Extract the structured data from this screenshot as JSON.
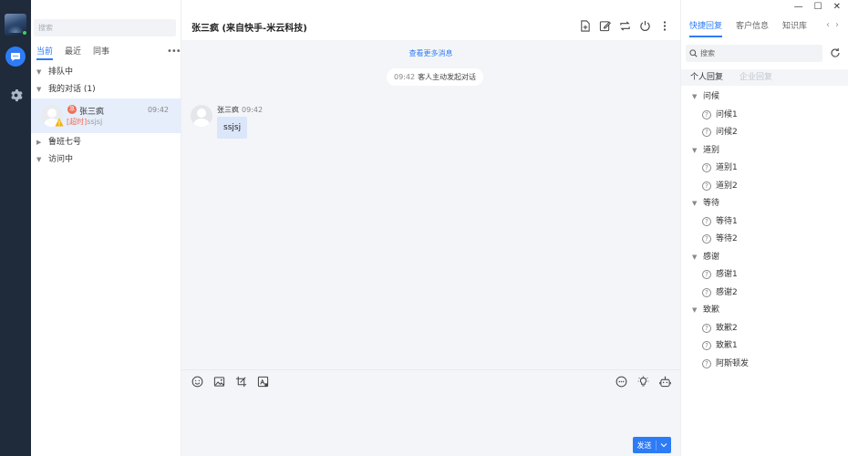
{
  "list": {
    "search_placeholder": "搜索",
    "tabs": [
      {
        "label": "当前",
        "active": true
      },
      {
        "label": "最近",
        "active": false
      },
      {
        "label": "同事",
        "active": false
      }
    ],
    "groups": {
      "queue": "排队中",
      "mine": "我的对话 (1)",
      "team": "鲁班七号",
      "visiting": "访问中"
    },
    "conversation": {
      "name": "张三疯",
      "time": "09:42",
      "badge": "急",
      "timeout_tag": "[超时]",
      "preview": "ssjsj"
    }
  },
  "chat": {
    "title": "张三疯 (来自快手-米云科技)",
    "more_messages": "查看更多消息",
    "system_message": {
      "time": "09:42",
      "text": "客人主动发起对话"
    },
    "message": {
      "sender": "张三疯",
      "time": "09:42",
      "text": "ssjsj"
    },
    "send_label": "发送"
  },
  "right": {
    "tabs": [
      {
        "label": "快捷回复",
        "active": true
      },
      {
        "label": "客户信息",
        "active": false
      },
      {
        "label": "知识库",
        "active": false
      }
    ],
    "search_placeholder": "搜索",
    "subtabs": [
      {
        "label": "个人回复",
        "active": true
      },
      {
        "label": "企业回复",
        "active": false
      }
    ],
    "reply_groups": [
      {
        "name": "问候",
        "items": [
          "问候1",
          "问候2"
        ]
      },
      {
        "name": "道别",
        "items": [
          "道别1",
          "道别2"
        ]
      },
      {
        "name": "等待",
        "items": [
          "等待1",
          "等待2"
        ]
      },
      {
        "name": "感谢",
        "items": [
          "感谢1",
          "感谢2"
        ]
      },
      {
        "name": "致歉",
        "items": [
          "致歉2",
          "致歉1",
          "阿斯顿发"
        ]
      }
    ]
  },
  "colors": {
    "accent": "#2d7cf6",
    "rail": "#1f2a3a",
    "selected_row": "#e6eefb",
    "bubble": "#dbe6fa",
    "alert": "#f06e55"
  }
}
